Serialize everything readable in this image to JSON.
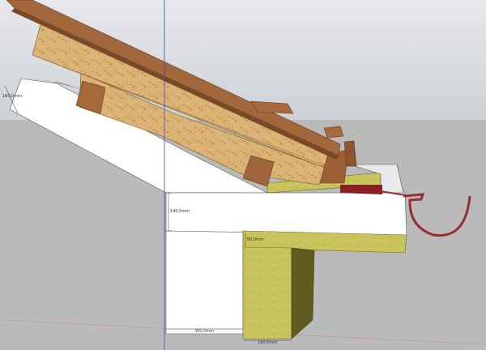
{
  "dimensions": {
    "wall_width": "300,0mm",
    "slab_height": "140,0mm",
    "roof_edge": "160,0mm",
    "insulation_width": "180,0mm",
    "fascia_small": "80,0mm"
  },
  "colors": {
    "sky_top": "#dfe2e8",
    "sky_bottom": "#c9ccd2",
    "ground": "#b9b9b9",
    "osb": "#d8b170",
    "timber": "#a2673a",
    "timber_dark": "#7a4a28",
    "mineral_wool": "#c8c25a",
    "white_concrete": "#ffffff",
    "gutter": "#9a2d33"
  }
}
